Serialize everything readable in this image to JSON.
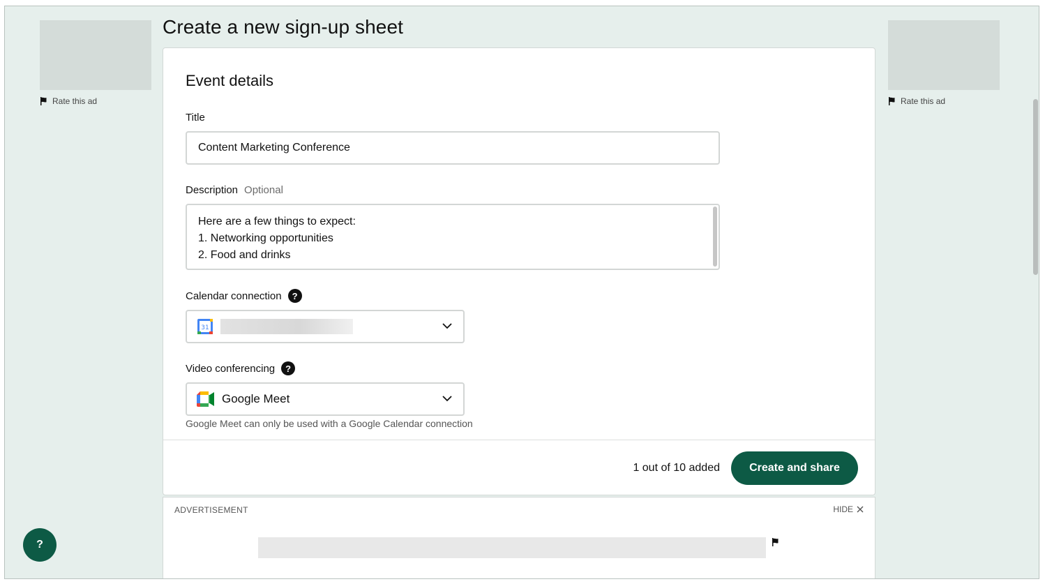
{
  "page": {
    "title": "Create a new sign-up sheet"
  },
  "ads": {
    "rate_label": "Rate this ad",
    "bottom_label": "ADVERTISEMENT",
    "hide_label": "HIDE"
  },
  "form": {
    "section_title": "Event details",
    "title_label": "Title",
    "title_value": "Content Marketing Conference",
    "description_label": "Description",
    "description_optional": "Optional",
    "description_lines": [
      "Here are a few things to expect:",
      "1. Networking opportunities",
      "2. Food and drinks"
    ],
    "calendar_label": "Calendar connection",
    "calendar_icon": "google-calendar-icon",
    "video_label": "Video conferencing",
    "video_value": "Google Meet",
    "video_icon": "google-meet-icon",
    "video_note": "Google Meet can only be used with a Google Calendar connection"
  },
  "footer": {
    "count_text": "1 out of 10 added",
    "create_button": "Create and share"
  },
  "help_fab": "?",
  "colors": {
    "page_background": "#e6efec",
    "brand_green": "#0d5a45"
  }
}
